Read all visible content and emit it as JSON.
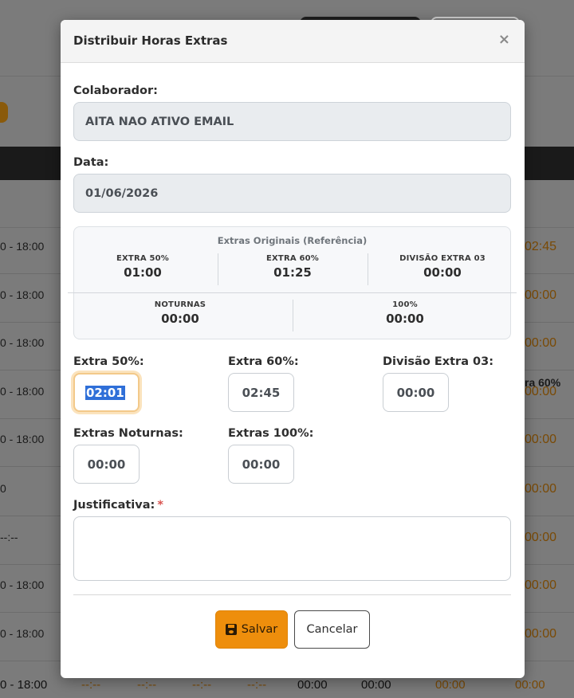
{
  "background": {
    "column_header": "ra 60%",
    "rows": [
      {
        "time": "0 - 18:00",
        "value": "02:45"
      },
      {
        "time": "0 - 18:00",
        "value": "00:00"
      },
      {
        "time": "0 - 18:00",
        "value": "00:00"
      },
      {
        "time": "0 - 18:00",
        "value": "00:00"
      },
      {
        "time": "0 - 18:00",
        "value": "00:00"
      },
      {
        "time": "0",
        "value": "00:00"
      },
      {
        "time": "--:--",
        "value": "00:00"
      },
      {
        "time": "0 - 18:00",
        "value": "00:00"
      },
      {
        "time": "0 - 18:00",
        "value": "00:00"
      }
    ],
    "last_row": {
      "time": "0 - 18:00",
      "cells": [
        "--:--",
        "--:--",
        "--:--",
        "--:--",
        "00:00",
        "00:00",
        "00:00",
        "00:00"
      ]
    }
  },
  "modal": {
    "title": "Distribuir Horas Extras",
    "close_symbol": "×",
    "colaborador_label": "Colaborador:",
    "colaborador_value": "AITA NAO ATIVO EMAIL",
    "data_label": "Data:",
    "data_value": "01/06/2026",
    "reference": {
      "title": "Extras Originais (Referência)",
      "items": [
        {
          "label": "EXTRA 50%",
          "value": "01:00"
        },
        {
          "label": "EXTRA 60%",
          "value": "01:25"
        },
        {
          "label": "DIVISÃO EXTRA 03",
          "value": "00:00"
        },
        {
          "label": "NOTURNAS",
          "value": "00:00"
        },
        {
          "label": "100%",
          "value": "00:00"
        }
      ]
    },
    "inputs": {
      "extra50_label": "Extra 50%:",
      "extra50_value": "02:01",
      "extra60_label": "Extra 60%:",
      "extra60_value": "02:45",
      "divisao03_label": "Divisão Extra 03:",
      "divisao03_value": "00:00",
      "noturnas_label": "Extras Noturnas:",
      "noturnas_value": "00:00",
      "extra100_label": "Extras 100%:",
      "extra100_value": "00:00"
    },
    "justificativa_label": "Justificativa:",
    "required_marker": "*",
    "save_label": "Salvar",
    "cancel_label": "Cancelar"
  },
  "colors": {
    "accent": "#ee8e0c",
    "focus_ring": "#f3c98a",
    "selection": "#2f6fd8",
    "required": "#d9534f"
  },
  "icons": {
    "save": "floppy-disk-icon",
    "close": "close-icon"
  }
}
